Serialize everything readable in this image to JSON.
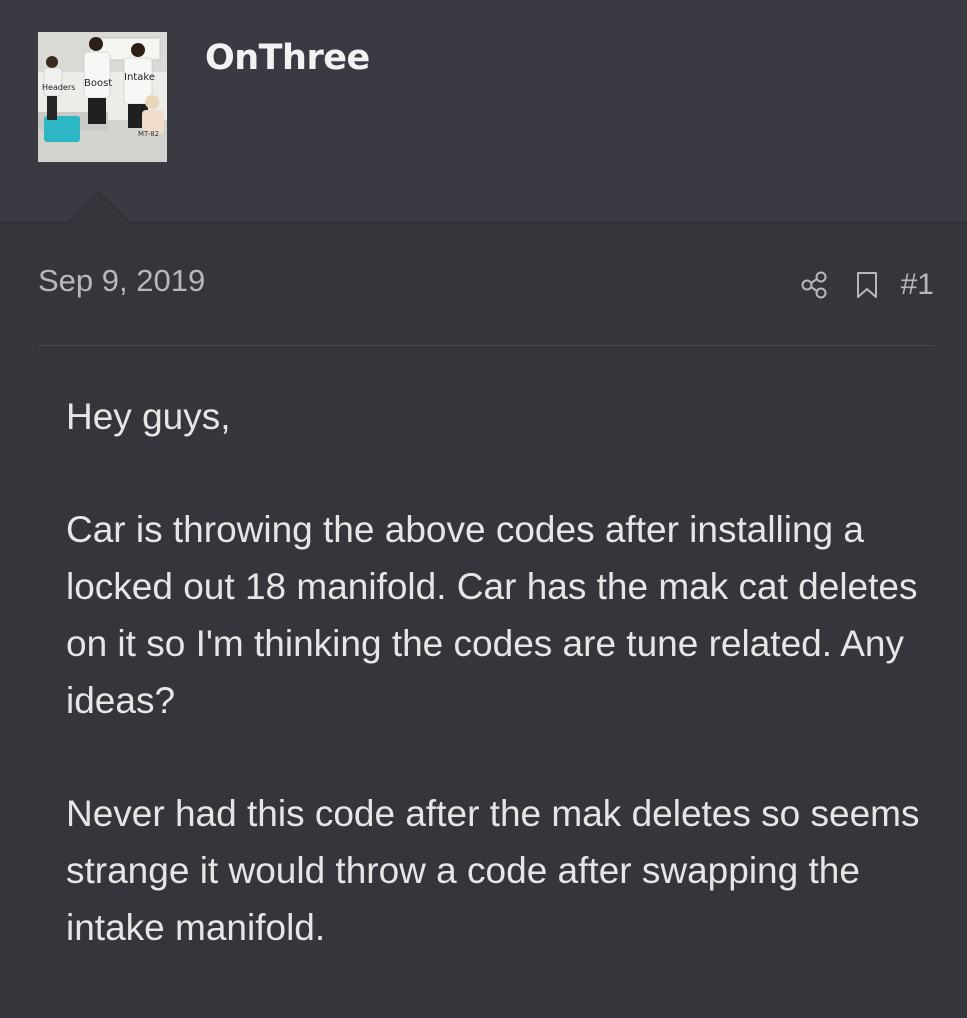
{
  "post": {
    "username": "OnThree",
    "date": "Sep 9, 2019",
    "post_number": "#1",
    "paragraphs": [
      "Hey guys,",
      "Car is throwing the above codes after installing a locked out 18 manifold. Car has the mak cat deletes on it so I'm thinking the codes are tune related. Any ideas?",
      "Never had this code after the mak deletes so seems strange it would throw a code after swapping the intake manifold."
    ]
  },
  "avatar": {
    "labels": {
      "left": "Headers",
      "middle": "Boost",
      "right": "Intake",
      "bottom": "MT-82"
    }
  },
  "icons": {
    "share": "share-icon",
    "bookmark": "bookmark-icon"
  },
  "colors": {
    "background": "#35363c",
    "header_background": "#3a3b42",
    "text": "#e6e6e6",
    "muted_text": "#b7b8bd"
  }
}
